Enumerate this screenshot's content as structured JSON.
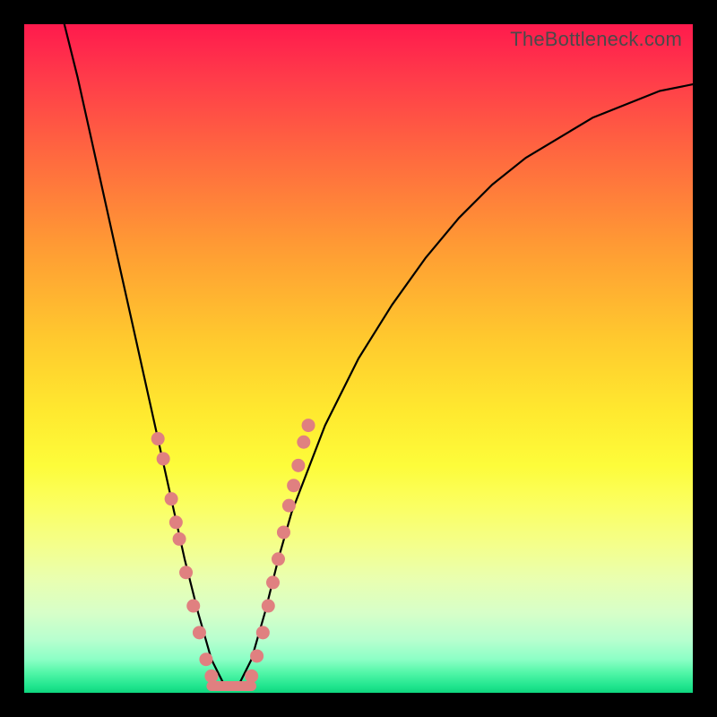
{
  "watermark": "TheBottleneck.com",
  "chart_data": {
    "type": "line",
    "title": "",
    "xlabel": "",
    "ylabel": "",
    "xlim": [
      0,
      100
    ],
    "ylim": [
      0,
      100
    ],
    "note": "V-shaped bottleneck curve over a vertical rainbow gradient. The curve minimum (optimal / no-bottleneck region) sits near x≈30 at the green bottom band; both arms rise toward red (high bottleneck).",
    "series": [
      {
        "name": "bottleneck-curve",
        "x": [
          6,
          8,
          10,
          12,
          14,
          16,
          18,
          20,
          22,
          24,
          26,
          28,
          30,
          32,
          34,
          36,
          38,
          40,
          45,
          50,
          55,
          60,
          65,
          70,
          75,
          80,
          85,
          90,
          95,
          100
        ],
        "y": [
          100,
          92,
          83,
          74,
          65,
          56,
          47,
          38,
          29,
          20,
          12,
          5,
          1,
          1,
          5,
          12,
          20,
          27,
          40,
          50,
          58,
          65,
          71,
          76,
          80,
          83,
          86,
          88,
          90,
          91
        ]
      }
    ],
    "flat_segment": {
      "x_start": 28,
      "x_end": 34,
      "y": 1
    },
    "highlight_points_left": [
      {
        "x": 20,
        "y": 38
      },
      {
        "x": 20.8,
        "y": 35
      },
      {
        "x": 22,
        "y": 29
      },
      {
        "x": 22.7,
        "y": 25.5
      },
      {
        "x": 23.2,
        "y": 23
      },
      {
        "x": 24.2,
        "y": 18
      },
      {
        "x": 25.3,
        "y": 13
      },
      {
        "x": 26.2,
        "y": 9
      },
      {
        "x": 27.2,
        "y": 5
      },
      {
        "x": 28,
        "y": 2.5
      }
    ],
    "highlight_points_right": [
      {
        "x": 34,
        "y": 2.5
      },
      {
        "x": 34.8,
        "y": 5.5
      },
      {
        "x": 35.7,
        "y": 9
      },
      {
        "x": 36.5,
        "y": 13
      },
      {
        "x": 37.2,
        "y": 16.5
      },
      {
        "x": 38,
        "y": 20
      },
      {
        "x": 38.8,
        "y": 24
      },
      {
        "x": 39.6,
        "y": 28
      },
      {
        "x": 40.3,
        "y": 31
      },
      {
        "x": 41,
        "y": 34
      },
      {
        "x": 41.8,
        "y": 37.5
      },
      {
        "x": 42.5,
        "y": 40
      }
    ],
    "colors": {
      "gradient_top": "#ff1a4d",
      "gradient_bottom": "#0fd67e",
      "curve": "#000000",
      "highlight": "#e08080"
    }
  }
}
